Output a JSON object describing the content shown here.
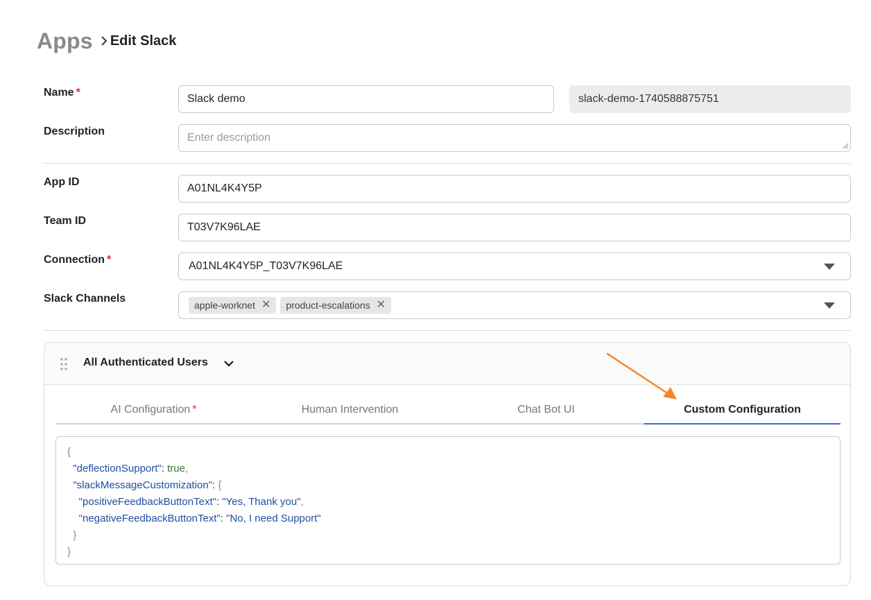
{
  "breadcrumb": {
    "root": "Apps",
    "current": "Edit Slack"
  },
  "form": {
    "name": {
      "label": "Name",
      "required_mark": "*",
      "value": "Slack demo",
      "slug": "slack-demo-1740588875751"
    },
    "description": {
      "label": "Description",
      "placeholder": "Enter description"
    },
    "app_id": {
      "label": "App ID",
      "value": "A01NL4K4Y5P"
    },
    "team_id": {
      "label": "Team ID",
      "value": "T03V7K96LAE"
    },
    "connection": {
      "label": "Connection",
      "required_mark": "*",
      "value": "A01NL4K4Y5P_T03V7K96LAE"
    },
    "slack_channels": {
      "label": "Slack Channels",
      "chips": [
        "apple-worknet",
        "product-escalations"
      ],
      "remove_glyph": "✕"
    }
  },
  "panel": {
    "title": "All Authenticated Users",
    "tabs": [
      {
        "label": "AI Configuration",
        "required_mark": "*"
      },
      {
        "label": "Human Intervention"
      },
      {
        "label": "Chat Bot UI"
      },
      {
        "label": "Custom Configuration"
      }
    ],
    "active_tab": 3,
    "code": {
      "open": "{",
      "close": "}",
      "deflection_key": "\"deflectionSupport\"",
      "deflection_value": "true",
      "customization_key": "\"slackMessageCustomization\"",
      "inner_open": "{",
      "inner_close": "}",
      "positive_key": "\"positiveFeedbackButtonText\"",
      "positive_value": "\"Yes, Thank you\"",
      "negative_key": "\"negativeFeedbackButtonText\"",
      "negative_value": "\"No, I need Support\""
    }
  },
  "colors": {
    "accent": "#3f63d6",
    "required": "#d32f2f",
    "annotation_arrow": "#f08a2c"
  }
}
